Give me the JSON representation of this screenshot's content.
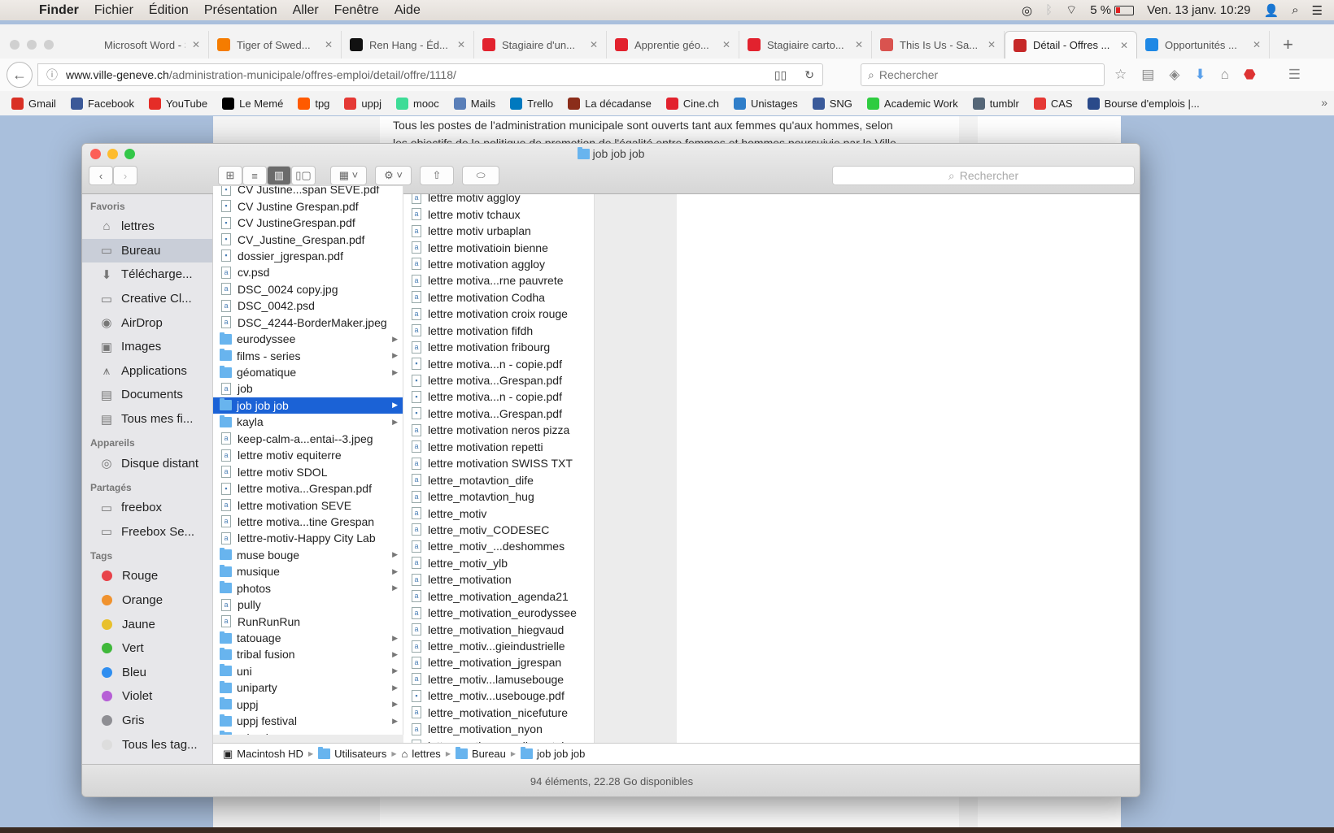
{
  "menubar": {
    "app": "Finder",
    "items": [
      "Fichier",
      "Édition",
      "Présentation",
      "Aller",
      "Fenêtre",
      "Aide"
    ],
    "battery": "5 %",
    "datetime": "Ven. 13 janv.  10:29"
  },
  "browser": {
    "tabs": [
      {
        "label": "Microsoft Word - S...",
        "color": "#f3f3f3"
      },
      {
        "label": "Tiger of Swed...",
        "color": "#f57c00"
      },
      {
        "label": "Ren Hang - Éd...",
        "color": "#111111"
      },
      {
        "label": "Stagiaire d'un...",
        "color": "#e2222e"
      },
      {
        "label": "Apprentie géo...",
        "color": "#e2222e"
      },
      {
        "label": "Stagiaire carto...",
        "color": "#e2222e"
      },
      {
        "label": "This Is Us - Sa...",
        "color": "#d9534f"
      },
      {
        "label": "Détail - Offres ...",
        "color": "#c62828",
        "active": true
      },
      {
        "label": "Opportunités ...",
        "color": "#1e88e5"
      }
    ],
    "url_domain": "www.ville-geneve.ch",
    "url_path": "/administration-municipale/offres-emploi/detail/offre/1118/",
    "search_placeholder": "Rechercher",
    "bookmarks": [
      {
        "label": "Gmail",
        "color": "#d93025"
      },
      {
        "label": "Facebook",
        "color": "#3b5998"
      },
      {
        "label": "YouTube",
        "color": "#e52d27"
      },
      {
        "label": "Le Memé",
        "color": "#000000"
      },
      {
        "label": "tpg",
        "color": "#ff5a00"
      },
      {
        "label": "uppj",
        "color": "#e53935"
      },
      {
        "label": "mooc",
        "color": "#3ddc97"
      },
      {
        "label": "Mails",
        "color": "#5a7fb8"
      },
      {
        "label": "Trello",
        "color": "#0079bf"
      },
      {
        "label": "La décadanse",
        "color": "#8b2d1a"
      },
      {
        "label": "Cine.ch",
        "color": "#e2222e"
      },
      {
        "label": "Unistages",
        "color": "#2f7ec9"
      },
      {
        "label": "SNG",
        "color": "#3a5a9a"
      },
      {
        "label": "Academic Work",
        "color": "#2ecc40"
      },
      {
        "label": "tumblr",
        "color": "#556677"
      },
      {
        "label": "CAS",
        "color": "#e53935"
      },
      {
        "label": "Bourse d'emplois |...",
        "color": "#2a4a8a"
      }
    ],
    "page_text_1": "Tous les postes de l'administration municipale sont ouverts tant aux femmes qu'aux hommes, selon",
    "page_text_2": "les objectifs de la politique de promotion de l'égalité entre femmes et hommes poursuivie par la Ville"
  },
  "finder": {
    "title": "job job job",
    "search_placeholder": "Rechercher",
    "sidebar": [
      {
        "header": "Favoris",
        "items": [
          {
            "label": "lettres",
            "icon": "home-icon"
          },
          {
            "label": "Bureau",
            "icon": "desktop-icon",
            "selected": true
          },
          {
            "label": "Télécharge...",
            "icon": "download-icon"
          },
          {
            "label": "Creative Cl...",
            "icon": "folder-icon"
          },
          {
            "label": "AirDrop",
            "icon": "airdrop-icon"
          },
          {
            "label": "Images",
            "icon": "camera-icon"
          },
          {
            "label": "Applications",
            "icon": "applications-icon"
          },
          {
            "label": "Documents",
            "icon": "documents-icon"
          },
          {
            "label": "Tous mes fi...",
            "icon": "all-files-icon"
          }
        ]
      },
      {
        "header": "Appareils",
        "items": [
          {
            "label": "Disque distant",
            "icon": "disc-icon"
          }
        ]
      },
      {
        "header": "Partagés",
        "items": [
          {
            "label": "freebox",
            "icon": "monitor-icon"
          },
          {
            "label": "Freebox Se...",
            "icon": "monitor-icon"
          }
        ]
      },
      {
        "header": "Tags",
        "items": [
          {
            "label": "Rouge",
            "color": "#e8434a"
          },
          {
            "label": "Orange",
            "color": "#f0922e"
          },
          {
            "label": "Jaune",
            "color": "#e8c02c"
          },
          {
            "label": "Vert",
            "color": "#3fb83a"
          },
          {
            "label": "Bleu",
            "color": "#2f8ef0"
          },
          {
            "label": "Violet",
            "color": "#b65fd6"
          },
          {
            "label": "Gris",
            "color": "#8e8e93"
          },
          {
            "label": "Tous les tag...",
            "color": "#dddddd"
          }
        ]
      }
    ],
    "column1": [
      {
        "n": "CV Justine...span SEVE.pdf"
      },
      {
        "n": "CV Justine Grespan.pdf"
      },
      {
        "n": "CV JustineGrespan.pdf"
      },
      {
        "n": "CV_Justine_Grespan.pdf"
      },
      {
        "n": "dossier_jgrespan.pdf"
      },
      {
        "n": "cv.psd"
      },
      {
        "n": "DSC_0024 copy.jpg"
      },
      {
        "n": "DSC_0042.psd"
      },
      {
        "n": "DSC_4244-BorderMaker.jpeg"
      },
      {
        "n": "eurodyssee",
        "f": true
      },
      {
        "n": "films - series",
        "f": true
      },
      {
        "n": "géomatique",
        "f": true
      },
      {
        "n": "job"
      },
      {
        "n": "job job job",
        "f": true,
        "sel": true
      },
      {
        "n": "kayla",
        "f": true
      },
      {
        "n": "keep-calm-a...entai--3.jpeg"
      },
      {
        "n": "lettre motiv equiterre"
      },
      {
        "n": "lettre motiv SDOL"
      },
      {
        "n": "lettre motiva...Grespan.pdf"
      },
      {
        "n": "lettre motivation SEVE"
      },
      {
        "n": "lettre motiva...tine Grespan"
      },
      {
        "n": "lettre-motiv-Happy City Lab"
      },
      {
        "n": "muse bouge",
        "f": true
      },
      {
        "n": "musique",
        "f": true
      },
      {
        "n": "photos",
        "f": true
      },
      {
        "n": "pully"
      },
      {
        "n": "RunRunRun"
      },
      {
        "n": "tatouage",
        "f": true
      },
      {
        "n": "tribal fusion",
        "f": true
      },
      {
        "n": "uni",
        "f": true
      },
      {
        "n": "uniparty",
        "f": true
      },
      {
        "n": "uppj",
        "f": true
      },
      {
        "n": "uppj festival",
        "f": true
      },
      {
        "n": "urbanisme",
        "f": true
      }
    ],
    "column2": [
      "lettre motiv aggloy",
      "lettre motiv tchaux",
      "lettre motiv urbaplan",
      "lettre motivatioin bienne",
      "lettre motivation aggloy",
      "lettre motiva...rne pauvrete",
      "lettre motivation Codha",
      "lettre motivation croix rouge",
      "lettre motivation fifdh",
      "lettre motivation fribourg",
      "lettre motiva...n - copie.pdf",
      "lettre motiva...Grespan.pdf",
      "lettre motiva...n - copie.pdf",
      "lettre motiva...Grespan.pdf",
      "lettre motivation neros pizza",
      "lettre motivation repetti",
      "lettre motivation SWISS TXT",
      "lettre_motavtion_dife",
      "lettre_motavtion_hug",
      "lettre_motiv",
      "lettre_motiv_CODESEC",
      "lettre_motiv_...deshommes",
      "lettre_motiv_ylb",
      "lettre_motivation",
      "lettre_motivation_agenda21",
      "lettre_motivation_eurodyssee",
      "lettre_motivation_hiegvaud",
      "lettre_motiv...gieindustrielle",
      "lettre_motivation_jgrespan",
      "lettre_motiv...lamusebouge",
      "lettre_motiv...usebouge.pdf",
      "lettre_motivation_nicefuture",
      "lettre_motivation_nyon",
      "lettre_motiva..._radiovostok"
    ],
    "path": [
      "Macintosh HD",
      "Utilisateurs",
      "lettres",
      "Bureau",
      "job job job"
    ],
    "status": "94 éléments, 22.28 Go disponibles"
  }
}
